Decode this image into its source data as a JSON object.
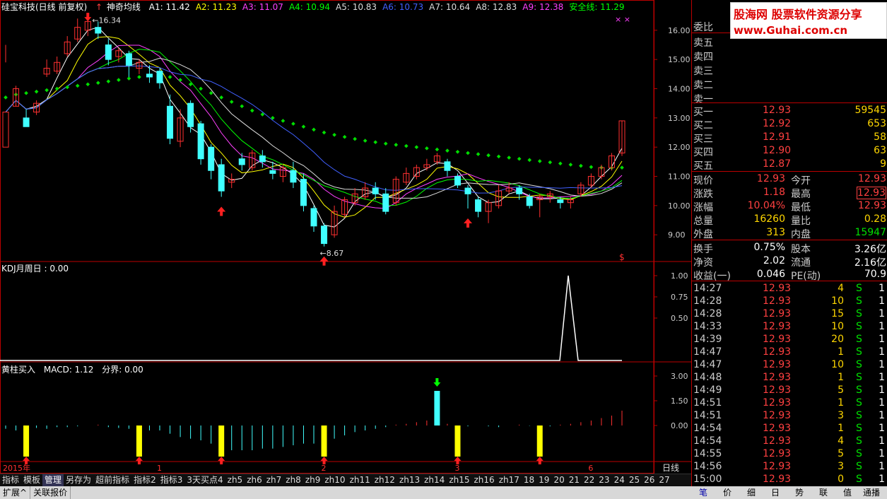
{
  "header": {
    "stock_name": "硅宝科技(日线 前复权)",
    "indicator_name": "神奇均线",
    "ma_values": [
      {
        "label": "A1: 11.42",
        "color": "#ffffff"
      },
      {
        "label": "A2: 11.23",
        "color": "#ffff00"
      },
      {
        "label": "A3: 11.07",
        "color": "#ff40ff"
      },
      {
        "label": "A4: 10.94",
        "color": "#00ff00"
      },
      {
        "label": "A5: 10.83",
        "color": "#dddddd"
      },
      {
        "label": "A6: 10.73",
        "color": "#4060ff"
      },
      {
        "label": "A7: 10.64",
        "color": "#dddddd"
      },
      {
        "label": "A8: 12.83",
        "color": "#dddddd"
      },
      {
        "label": "A9: 12.38",
        "color": "#ff40ff"
      },
      {
        "label": "安全线: 11.29",
        "color": "#00ff00"
      }
    ]
  },
  "main_chart": {
    "price_ticks": [
      "16.00",
      "15.00",
      "14.00",
      "13.00",
      "12.00",
      "11.00",
      "10.00",
      "9.00"
    ],
    "high_label": "16.34",
    "low_label": "8.67",
    "dollar_marker": "$",
    "candles": [
      [
        12.0,
        13.2,
        14.9,
        15.5
      ],
      [
        13.4,
        14.0,
        14.1,
        13.4
      ],
      [
        13.0,
        12.7,
        13.3,
        12.7
      ],
      [
        13.2,
        13.5,
        13.6,
        13.1
      ],
      [
        14.5,
        14.7,
        15.0,
        14.4
      ],
      [
        14.6,
        14.9,
        15.1,
        14.5
      ],
      [
        15.2,
        15.6,
        15.8,
        15.1
      ],
      [
        15.7,
        16.1,
        16.4,
        15.6
      ],
      [
        16.0,
        16.3,
        16.5,
        15.8
      ],
      [
        16.1,
        15.9,
        16.3,
        15.7
      ],
      [
        15.5,
        15.0,
        15.7,
        14.8
      ],
      [
        15.1,
        15.3,
        15.4,
        14.9
      ],
      [
        15.2,
        14.8,
        15.3,
        14.4
      ],
      [
        14.7,
        14.9,
        15.0,
        14.5
      ],
      [
        14.5,
        14.4,
        14.8,
        14.2
      ],
      [
        14.6,
        14.2,
        14.7,
        14.0
      ],
      [
        13.4,
        12.3,
        13.8,
        12.1
      ],
      [
        12.2,
        13.0,
        13.3,
        12.0
      ],
      [
        13.5,
        12.7,
        13.6,
        12.5
      ],
      [
        12.8,
        11.6,
        12.9,
        11.4
      ],
      [
        12.0,
        11.2,
        12.1,
        10.9
      ],
      [
        11.4,
        10.5,
        11.6,
        10.3
      ],
      [
        10.8,
        10.9,
        11.1,
        10.6
      ],
      [
        11.6,
        11.4,
        11.8,
        11.2
      ],
      [
        11.3,
        11.8,
        11.9,
        11.2
      ],
      [
        11.7,
        11.5,
        11.9,
        11.3
      ],
      [
        11.2,
        11.1,
        11.5,
        10.9
      ],
      [
        11.0,
        11.3,
        11.4,
        10.8
      ],
      [
        11.2,
        10.8,
        11.5,
        10.6
      ],
      [
        10.9,
        10.0,
        11.1,
        9.8
      ],
      [
        9.9,
        9.3,
        10.0,
        9.1
      ],
      [
        9.3,
        8.7,
        9.4,
        8.6
      ],
      [
        9.0,
        9.8,
        10.0,
        8.9
      ],
      [
        9.7,
        10.2,
        10.3,
        9.6
      ],
      [
        10.1,
        10.4,
        10.6,
        10.0
      ],
      [
        10.3,
        10.6,
        10.8,
        10.2
      ],
      [
        10.6,
        10.4,
        10.8,
        10.2
      ],
      [
        10.4,
        9.8,
        10.6,
        9.7
      ],
      [
        10.1,
        10.9,
        11.0,
        10.0
      ],
      [
        10.8,
        11.1,
        11.3,
        10.7
      ],
      [
        11.0,
        11.3,
        11.4,
        10.9
      ],
      [
        11.3,
        11.4,
        11.6,
        11.2
      ],
      [
        11.5,
        11.7,
        11.8,
        11.4
      ],
      [
        11.5,
        11.2,
        11.6,
        11.0
      ],
      [
        11.0,
        10.7,
        11.1,
        10.6
      ],
      [
        10.6,
        10.4,
        10.7,
        9.9
      ],
      [
        10.2,
        9.8,
        10.3,
        9.6
      ],
      [
        9.8,
        10.1,
        10.2,
        9.4
      ],
      [
        10.0,
        10.5,
        10.7,
        9.9
      ],
      [
        10.5,
        10.6,
        10.8,
        10.4
      ],
      [
        10.6,
        10.4,
        10.7,
        10.2
      ],
      [
        10.3,
        10.0,
        10.4,
        9.9
      ],
      [
        10.2,
        10.3,
        10.4,
        9.6
      ],
      [
        10.3,
        10.4,
        10.5,
        10.1
      ],
      [
        10.2,
        10.1,
        10.3,
        9.9
      ],
      [
        10.1,
        10.2,
        10.3,
        9.9
      ],
      [
        10.4,
        10.7,
        10.8,
        10.3
      ],
      [
        10.7,
        11.0,
        11.1,
        10.6
      ],
      [
        11.0,
        11.3,
        11.4,
        10.9
      ],
      [
        11.3,
        11.7,
        11.8,
        11.2
      ],
      [
        11.8,
        12.9,
        12.9,
        11.7
      ]
    ],
    "safety_line": [
      13.7,
      13.8,
      13.85,
      13.9,
      13.95,
      14.0,
      14.05,
      14.1,
      14.15,
      14.2,
      14.25,
      14.3,
      14.35,
      14.4,
      14.45,
      14.45,
      14.4,
      14.3,
      14.15,
      14.0,
      13.85,
      13.7,
      13.55,
      13.4,
      13.25,
      13.12,
      13.0,
      12.9,
      12.8,
      12.7,
      12.6,
      12.5,
      12.42,
      12.35,
      12.28,
      12.22,
      12.17,
      12.12,
      12.08,
      12.04,
      12.0,
      11.96,
      11.92,
      11.88,
      11.84,
      11.8,
      11.76,
      11.72,
      11.68,
      11.64,
      11.6,
      11.56,
      11.52,
      11.48,
      11.44,
      11.4,
      11.36,
      11.32,
      11.3,
      11.29,
      11.3
    ],
    "buy_arrow_indices": [
      21,
      31,
      45
    ],
    "sell_arrow_index": 8
  },
  "kdj": {
    "title": "KDJ月周日 : 0.00",
    "ticks": [
      "1.00",
      "0.75",
      "0.50"
    ]
  },
  "macd": {
    "title_prefix": "黄柱买入",
    "title_macd": "MACD: 1.12",
    "title_split": "分界: 0.00",
    "ticks": [
      "3.00",
      "1.50",
      "0.00"
    ],
    "bars": [
      -0.2,
      -0.3,
      -0.1,
      -0.15,
      -0.2,
      -0.1,
      -0.1,
      -0.05,
      0,
      0.05,
      -0.1,
      -0.15,
      -0.2,
      -0.25,
      -0.3,
      -0.3,
      -0.5,
      -0.7,
      -0.8,
      -0.9,
      -1.1,
      -1.3,
      -1.5,
      -1.5,
      -1.5,
      -1.4,
      -1.4,
      -1.3,
      -1.2,
      -1.1,
      -1.1,
      -1.0,
      -0.8,
      -0.6,
      -0.4,
      -0.3,
      -0.2,
      -0.1,
      0.05,
      0.1,
      0.2,
      0.3,
      2.1,
      0.1,
      -0.1,
      -0.05,
      0,
      -0.05,
      -0.1,
      0,
      0.05,
      -0.02,
      0.02,
      -0.05,
      0.05,
      0.1,
      0.2,
      0.3,
      0.45,
      0.6,
      0.9
    ],
    "yellow_indices": [
      2,
      13,
      21,
      31,
      44,
      52
    ],
    "green_arrow_index": 42
  },
  "time_axis": {
    "labels": [
      {
        "text": "2015年",
        "idx": 0
      },
      {
        "text": "1",
        "idx": 15
      },
      {
        "text": "2",
        "idx": 31
      },
      {
        "text": "3",
        "idx": 44
      },
      {
        "text": "6",
        "idx": 57
      }
    ],
    "period": "日线"
  },
  "tabs": [
    "指标",
    "模板",
    "管理",
    "另存为",
    "超前指标",
    "指标2",
    "指标3",
    "3天买点4",
    "zh5",
    "zh6",
    "zh7",
    "zh8",
    "zh9",
    "zh10",
    "zh11",
    "zh12",
    "zh13",
    "zh14",
    "zh15",
    "zh16",
    "zh17",
    "18",
    "19",
    "20",
    "21",
    "22",
    "23",
    "24",
    "25",
    "26",
    "27"
  ],
  "selected_tab": "管理",
  "tab_controls": [
    "+",
    "-",
    "0"
  ],
  "quote": {
    "weibi_label": "委比",
    "asks": [
      {
        "label": "卖五"
      },
      {
        "label": "卖四"
      },
      {
        "label": "卖三"
      },
      {
        "label": "卖二"
      },
      {
        "label": "卖一"
      }
    ],
    "bids": [
      {
        "label": "买一",
        "price": "12.93",
        "vol": "59545"
      },
      {
        "label": "买二",
        "price": "12.92",
        "vol": "653"
      },
      {
        "label": "买三",
        "price": "12.91",
        "vol": "58"
      },
      {
        "label": "买四",
        "price": "12.90",
        "vol": "63"
      },
      {
        "label": "买五",
        "price": "12.87",
        "vol": "9"
      }
    ],
    "stats": [
      {
        "l1": "现价",
        "v1": "12.93",
        "l2": "今开",
        "v2": "12.93"
      },
      {
        "l1": "涨跌",
        "v1": "1.18",
        "l2": "最高",
        "v2": "12.93"
      },
      {
        "l1": "涨幅",
        "v1": "10.04%",
        "l2": "最低",
        "v2": "12.93"
      },
      {
        "l1": "总量",
        "v1": "16260",
        "l2": "量比",
        "v2": "0.28"
      },
      {
        "l1": "外盘",
        "v1": "313",
        "l2": "内盘",
        "v2": "15947"
      }
    ],
    "fundamentals": [
      {
        "l1": "换手",
        "v1": "0.75%",
        "l2": "股本",
        "v2": "3.26亿"
      },
      {
        "l1": "净资",
        "v1": "2.02",
        "l2": "流通",
        "v2": "2.16亿"
      },
      {
        "l1": "收益(一)",
        "v1": "0.046",
        "l2": "PE(动)",
        "v2": "70.9"
      }
    ],
    "ticks": [
      {
        "time": "14:27",
        "price": "12.93",
        "vol": "4",
        "side": "S",
        "n": "1"
      },
      {
        "time": "14:28",
        "price": "12.93",
        "vol": "10",
        "side": "S",
        "n": "1"
      },
      {
        "time": "14:28",
        "price": "12.93",
        "vol": "15",
        "side": "S",
        "n": "1"
      },
      {
        "time": "14:33",
        "price": "12.93",
        "vol": "10",
        "side": "S",
        "n": "1"
      },
      {
        "time": "14:39",
        "price": "12.93",
        "vol": "20",
        "side": "S",
        "n": "1"
      },
      {
        "time": "14:47",
        "price": "12.93",
        "vol": "1",
        "side": "S",
        "n": "1"
      },
      {
        "time": "14:47",
        "price": "12.93",
        "vol": "10",
        "side": "S",
        "n": "1"
      },
      {
        "time": "14:48",
        "price": "12.93",
        "vol": "1",
        "side": "S",
        "n": "1"
      },
      {
        "time": "14:49",
        "price": "12.93",
        "vol": "5",
        "side": "S",
        "n": "1"
      },
      {
        "time": "14:51",
        "price": "12.93",
        "vol": "1",
        "side": "S",
        "n": "1"
      },
      {
        "time": "14:51",
        "price": "12.93",
        "vol": "3",
        "side": "S",
        "n": "1"
      },
      {
        "time": "14:54",
        "price": "12.93",
        "vol": "1",
        "side": "S",
        "n": "1"
      },
      {
        "time": "14:54",
        "price": "12.93",
        "vol": "4",
        "side": "S",
        "n": "1"
      },
      {
        "time": "14:55",
        "price": "12.93",
        "vol": "5",
        "side": "S",
        "n": "1"
      },
      {
        "time": "14:56",
        "price": "12.93",
        "vol": "3",
        "side": "S",
        "n": "1"
      },
      {
        "time": "15:00",
        "price": "12.93",
        "vol": "0",
        "side": "S",
        "n": "1"
      }
    ]
  },
  "watermark": {
    "line1": "股海网 股票软件资源分享",
    "line2": "www.Guhai.com.cn"
  },
  "bottom_left": [
    "扩展^",
    "关联报价"
  ],
  "bottom_right": [
    "笔",
    "价",
    "细",
    "日",
    "势",
    "联",
    "值",
    "通播"
  ]
}
